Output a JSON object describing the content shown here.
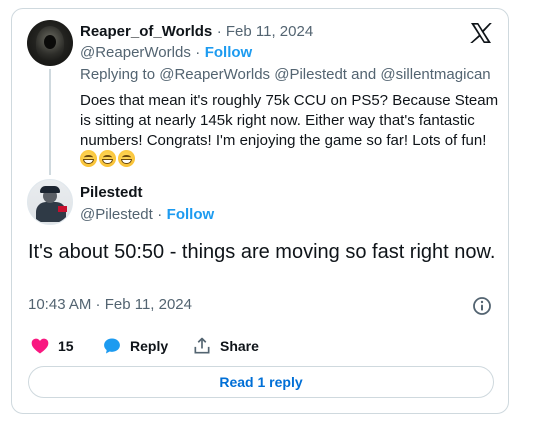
{
  "parent_tweet": {
    "display_name": "Reaper_of_Worlds",
    "date": "· Feb 11, 2024",
    "handle": "@ReaperWorlds",
    "separator": "·",
    "follow_label": "Follow",
    "replying_prefix": "Replying to",
    "replying_mention_1": "@ReaperWorlds",
    "replying_mention_2": "@Pilestedt",
    "replying_and": "and",
    "replying_mention_3": "@sillentmagican",
    "text": "Does that mean it's roughly 75k CCU on PS5? Because Steam is sitting at nearly 145k right now. Either way that's fantastic numbers! Congrats! I'm enjoying the game so far! Lots of fun!",
    "emoji": [
      "grinning-face-with-smiling-eyes",
      "grinning-face-with-smiling-eyes",
      "grinning-face-with-smiling-eyes"
    ]
  },
  "main_tweet": {
    "display_name": "Pilestedt",
    "handle": "@Pilestedt",
    "separator": "·",
    "follow_label": "Follow",
    "text": "It's about 50:50 - things are moving so fast right now.",
    "timestamp": "10:43 AM · Feb 11, 2024"
  },
  "actions": {
    "like_count": "15",
    "reply_label": "Reply",
    "share_label": "Share"
  },
  "read_replies_label": "Read 1 reply",
  "colors": {
    "link": "#1d9bf0",
    "like": "#f91880",
    "reply": "#1d9bf0",
    "muted": "#536471",
    "border": "#cfd9de"
  },
  "icons": {
    "brand": "x-logo-icon",
    "info": "info-icon",
    "like": "heart-icon",
    "reply": "speech-bubble-icon",
    "share": "share-icon"
  }
}
